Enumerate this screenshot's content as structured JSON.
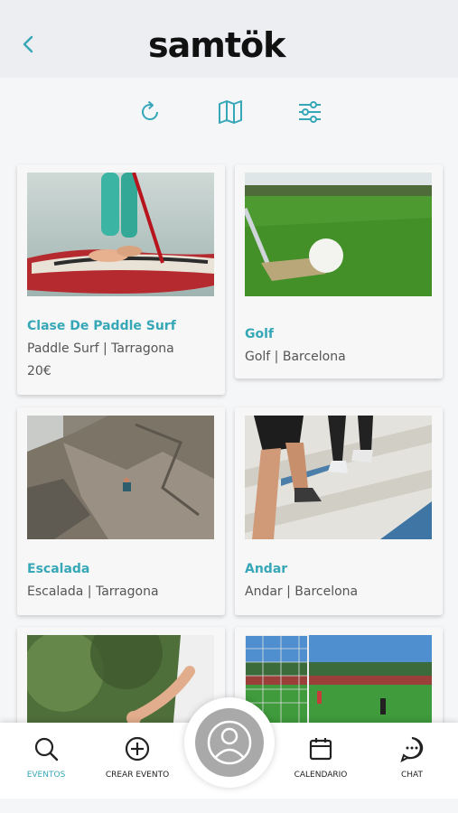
{
  "app": {
    "logo_text": "samtök"
  },
  "toolbar": {
    "refresh": "refresh-icon",
    "map": "map-icon",
    "filters": "filter-icon"
  },
  "events": [
    {
      "title": "Clase De Paddle Surf",
      "subtitle": "Paddle Surf | Tarragona",
      "price": "20€",
      "image": "paddle-surf-photo"
    },
    {
      "title": "Golf",
      "subtitle": "Golf | Barcelona",
      "image": "golf-photo"
    },
    {
      "title": "Escalada",
      "subtitle": "Escalada | Tarragona",
      "image": "climbing-photo"
    },
    {
      "title": "Andar",
      "subtitle": "Andar | Barcelona",
      "image": "walking-photo"
    },
    {
      "title": "",
      "subtitle": "",
      "image": "yoga-photo"
    },
    {
      "title": "",
      "subtitle": "",
      "image": "football-photo"
    }
  ],
  "nav": {
    "items": [
      {
        "label": "EVENTOS",
        "icon": "search-icon",
        "active": true
      },
      {
        "label": "CREAR EVENTO",
        "icon": "add-circle-icon",
        "active": false
      },
      {
        "label": "CALENDARIO",
        "icon": "calendar-icon",
        "active": false
      },
      {
        "label": "CHAT",
        "icon": "chat-icon",
        "active": false
      }
    ],
    "center": "profile-icon"
  },
  "colors": {
    "accent": "#36a7b6",
    "header_bg": "#eceef1",
    "page_bg": "#f5f6f8"
  }
}
